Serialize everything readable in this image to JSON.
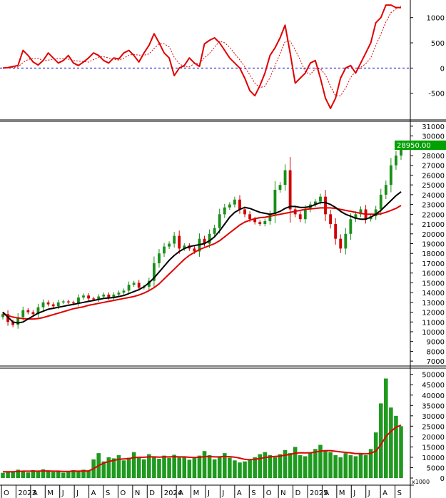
{
  "colors": {
    "background": "#ffffff",
    "price_line": "#e00000",
    "up_candle": "#1a8f1a",
    "down_candle": "#d00000",
    "ma_fast": "#000000",
    "ma_slow": "#e00000",
    "volume_bar": "#1f9a1f",
    "zero_line": "#0000cc",
    "last_price_box": "#00a000",
    "last_price_text": "#ffffff"
  },
  "chart_data": [
    {
      "type": "line",
      "panel": "oscillator",
      "ylim": [
        -1000,
        1350
      ],
      "y_ticks": [
        "1000",
        "500",
        "0",
        "-500"
      ],
      "zero_line": true,
      "series": [
        {
          "values": [
            0,
            10,
            30,
            50,
            350,
            250,
            120,
            60,
            150,
            300,
            200,
            100,
            150,
            250,
            100,
            50,
            120,
            200,
            300,
            250,
            150,
            100,
            200,
            180,
            300,
            350,
            250,
            120,
            300,
            450,
            680,
            500,
            300,
            200,
            -150,
            0,
            50,
            200,
            100,
            30,
            480,
            550,
            600,
            500,
            350,
            200,
            100,
            0,
            -200,
            -450,
            -550,
            -350,
            -100,
            250,
            400,
            600,
            850,
            300,
            -300,
            -200,
            -100,
            100,
            150,
            -200,
            -600,
            -800,
            -600,
            -200,
            0,
            50,
            -100,
            100,
            300,
            500,
            900,
            1000,
            1250,
            1250,
            1200,
            1200
          ]
        }
      ]
    },
    {
      "type": "candlestick",
      "panel": "price",
      "ylim": [
        6500,
        31500
      ],
      "y_ticks": [
        "31000",
        "30000",
        "29000",
        "28000",
        "27000",
        "26000",
        "25000",
        "24000",
        "23000",
        "22000",
        "21000",
        "20000",
        "19000",
        "18000",
        "17000",
        "16000",
        "15000",
        "14000",
        "13000",
        "12000",
        "11000",
        "10000",
        "9000",
        "8000",
        "7000"
      ],
      "last_price_label": "28950.00",
      "close": [
        11800,
        11000,
        10700,
        11500,
        12200,
        12000,
        11800,
        12500,
        13000,
        12800,
        12600,
        13000,
        13100,
        13000,
        12900,
        13500,
        13700,
        13400,
        13300,
        13600,
        13800,
        13500,
        13800,
        14000,
        14200,
        14800,
        15000,
        14500,
        14600,
        15200,
        17000,
        18000,
        18700,
        19000,
        19800,
        18500,
        18800,
        18500,
        18200,
        19500,
        19000,
        20000,
        20600,
        22000,
        22700,
        23000,
        23500,
        22500,
        22000,
        21500,
        21200,
        21000,
        21300,
        22000,
        24500,
        25000,
        26500,
        22500,
        22000,
        21500,
        22500,
        23000,
        23300,
        23800,
        22000,
        21000,
        19500,
        18500,
        20000,
        21500,
        22000,
        22500,
        21500,
        21800,
        22500,
        24000,
        25000,
        27000,
        28000,
        28950
      ],
      "series": [
        {
          "name": "MA fast",
          "values": [
            12000,
            11500,
            11000,
            10900,
            11000,
            11300,
            11600,
            11900,
            12100,
            12300,
            12400,
            12500,
            12600,
            12700,
            12800,
            12900,
            13000,
            13100,
            13200,
            13300,
            13400,
            13450,
            13500,
            13600,
            13700,
            13900,
            14100,
            14300,
            14600,
            15000,
            15500,
            16100,
            16700,
            17300,
            17800,
            18200,
            18500,
            18700,
            18800,
            18900,
            19000,
            19300,
            19700,
            20300,
            21000,
            21700,
            22200,
            22500,
            22700,
            22600,
            22400,
            22200,
            22100,
            22000,
            22100,
            22300,
            22600,
            22800,
            22800,
            22700,
            22700,
            22800,
            23000,
            23200,
            23200,
            23000,
            22700,
            22300,
            22000,
            21800,
            21600,
            21500,
            21500,
            21700,
            22000,
            22400,
            22900,
            23400,
            23900,
            24300
          ]
        },
        {
          "name": "MA slow",
          "values": [
            11800,
            11650,
            11500,
            11400,
            11350,
            11300,
            11300,
            11350,
            11450,
            11600,
            11750,
            11900,
            12050,
            12200,
            12350,
            12450,
            12550,
            12700,
            12800,
            12900,
            13000,
            13100,
            13200,
            13300,
            13400,
            13500,
            13600,
            13750,
            13950,
            14200,
            14500,
            14900,
            15400,
            15900,
            16400,
            16900,
            17400,
            17800,
            18100,
            18400,
            18600,
            18800,
            19000,
            19300,
            19700,
            20100,
            20500,
            20900,
            21200,
            21400,
            21550,
            21650,
            21700,
            21800,
            21900,
            22000,
            22100,
            22200,
            22300,
            22400,
            22500,
            22550,
            22600,
            22650,
            22650,
            22650,
            22600,
            22500,
            22400,
            22300,
            22200,
            22100,
            22000,
            22000,
            22000,
            22050,
            22200,
            22400,
            22600,
            22900
          ]
        }
      ]
    },
    {
      "type": "bar",
      "panel": "volume",
      "ylim": [
        0,
        53000
      ],
      "y_ticks": [
        "50000",
        "45000",
        "40000",
        "35000",
        "30000",
        "25000",
        "20000",
        "15000",
        "10000",
        "5000",
        "0"
      ],
      "unit_label": "x1000",
      "values": [
        2500,
        3200,
        2800,
        4000,
        3500,
        2700,
        3800,
        3000,
        4200,
        3600,
        2900,
        3300,
        2600,
        3000,
        3800,
        3200,
        4000,
        3500,
        9000,
        12000,
        8000,
        10000,
        9500,
        11000,
        8500,
        9800,
        12500,
        10200,
        9000,
        11500,
        10000,
        9300,
        10800,
        9700,
        11200,
        9900,
        10500,
        8800,
        9600,
        10800,
        13000,
        11000,
        9000,
        10500,
        12000,
        9800,
        8500,
        7500,
        8000,
        9000,
        10000,
        11500,
        12500,
        11000,
        10000,
        11500,
        13500,
        12000,
        15000,
        11000,
        10500,
        12000,
        14000,
        16000,
        13000,
        12500,
        11000,
        10000,
        12000,
        11000,
        10500,
        12000,
        11000,
        14000,
        22000,
        36000,
        48000,
        34000,
        30000,
        25000
      ],
      "series": [
        {
          "name": "Volume MA",
          "values": [
            3000,
            3000,
            3000,
            3200,
            3300,
            3300,
            3300,
            3300,
            3400,
            3400,
            3300,
            3300,
            3200,
            3200,
            3300,
            3300,
            3400,
            3400,
            4500,
            6000,
            7200,
            8000,
            8500,
            9000,
            9200,
            9400,
            9800,
            10000,
            10000,
            10200,
            10200,
            10100,
            10200,
            10200,
            10300,
            10200,
            10200,
            10000,
            9900,
            10000,
            10300,
            10400,
            10200,
            10200,
            10400,
            10300,
            10100,
            9600,
            9000,
            8800,
            9000,
            9400,
            9900,
            10200,
            10400,
            10600,
            11000,
            11400,
            12000,
            12200,
            12100,
            12200,
            12500,
            13000,
            13200,
            13200,
            12900,
            12600,
            12400,
            12100,
            11800,
            11800,
            11600,
            11900,
            13000,
            16000,
            20000,
            22500,
            24500,
            25500
          ]
        }
      ]
    }
  ],
  "x_axis": {
    "labels": [
      "O",
      "2023",
      "A",
      "M",
      "J",
      "J",
      "A",
      "S",
      "O",
      "N",
      "D",
      "2024",
      "A",
      "M",
      "J",
      "J",
      "A",
      "S",
      "O",
      "N",
      "D",
      "2025",
      "A",
      "M",
      "J",
      "J",
      "A",
      "S"
    ]
  }
}
